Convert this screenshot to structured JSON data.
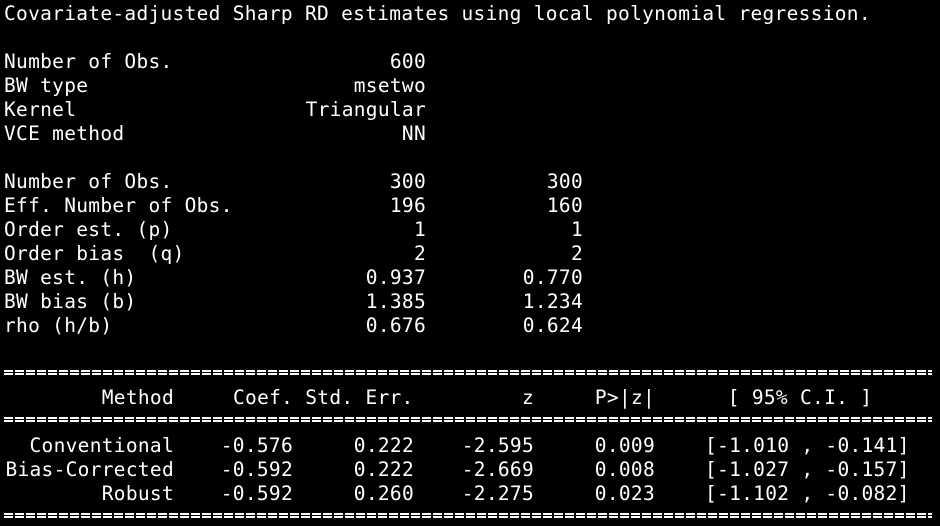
{
  "header": {
    "title": "Covariate-adjusted Sharp RD estimates using local polynomial regression."
  },
  "summary": [
    {
      "label": "Number of Obs.",
      "value": "600"
    },
    {
      "label": "BW type",
      "value": "msetwo"
    },
    {
      "label": "Kernel",
      "value": "Triangular"
    },
    {
      "label": "VCE method",
      "value": "NN"
    }
  ],
  "sides": [
    {
      "label": "Number of Obs.",
      "left": "300",
      "right": "300"
    },
    {
      "label": "Eff. Number of Obs.",
      "left": "196",
      "right": "160"
    },
    {
      "label": "Order est. (p)",
      "left": "1",
      "right": "1"
    },
    {
      "label": "Order bias  (q)",
      "left": "2",
      "right": "2"
    },
    {
      "label": "BW est. (h)",
      "left": "0.937",
      "right": "0.770"
    },
    {
      "label": "BW bias (b)",
      "left": "1.385",
      "right": "1.234"
    },
    {
      "label": "rho (h/b)",
      "left": "0.676",
      "right": "0.624"
    }
  ],
  "results": {
    "headers": {
      "method": "Method",
      "coef_se": "Coef. Std. Err.",
      "z": "z",
      "p": "P>|z|",
      "ci": "[ 95% C.I. ]"
    },
    "rows": [
      {
        "method": "Conventional",
        "coef": "-0.576",
        "se": "0.222",
        "z": "-2.595",
        "p": "0.009",
        "ci": "[-1.010 , -0.141]"
      },
      {
        "method": "Bias-Corrected",
        "coef": "-0.592",
        "se": "0.222",
        "z": "-2.669",
        "p": "0.008",
        "ci": "[-1.027 , -0.157]"
      },
      {
        "method": "Robust",
        "coef": "-0.592",
        "se": "0.260",
        "z": "-2.275",
        "p": "0.023",
        "ci": "[-1.102 , -0.082]"
      }
    ]
  },
  "colors": {
    "background": "#000000",
    "text": "#ffffff"
  }
}
